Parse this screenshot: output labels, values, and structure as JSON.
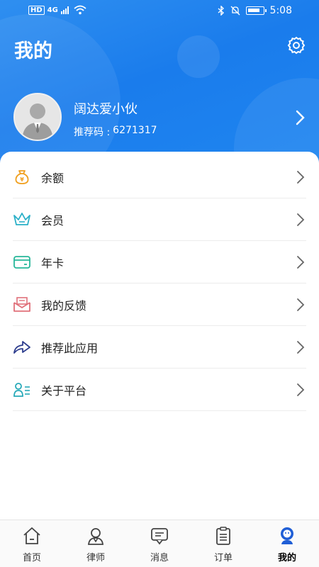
{
  "status_bar": {
    "network": "HD",
    "signal_gen": "4G",
    "time": "5:08"
  },
  "header": {
    "title": "我的"
  },
  "profile": {
    "name": "阔达爱小伙",
    "ref_label": "推荐码 :",
    "ref_code": "6271317"
  },
  "menu": [
    {
      "label": "余额",
      "icon": "wallet-icon"
    },
    {
      "label": "会员",
      "icon": "crown-icon"
    },
    {
      "label": "年卡",
      "icon": "card-icon"
    },
    {
      "label": "我的反馈",
      "icon": "feedback-mail-icon"
    },
    {
      "label": "推荐此应用",
      "icon": "share-arrow-icon"
    },
    {
      "label": "关于平台",
      "icon": "about-user-icon"
    }
  ],
  "tabbar": [
    {
      "label": "首页",
      "icon": "home-icon"
    },
    {
      "label": "律师",
      "icon": "lawyer-icon"
    },
    {
      "label": "消息",
      "icon": "message-icon"
    },
    {
      "label": "订单",
      "icon": "order-icon"
    },
    {
      "label": "我的",
      "icon": "profile-icon",
      "active": true
    }
  ],
  "colors": {
    "header_blue": "#1a7cec",
    "active_tab": "#1f5ed6",
    "wallet_orange": "#f0a020",
    "crown_teal": "#2ab0c8",
    "card_green": "#28b79a",
    "feedback_red": "#e0707a",
    "share_navy": "#2f3f8f",
    "about_teal": "#27a9b8"
  }
}
